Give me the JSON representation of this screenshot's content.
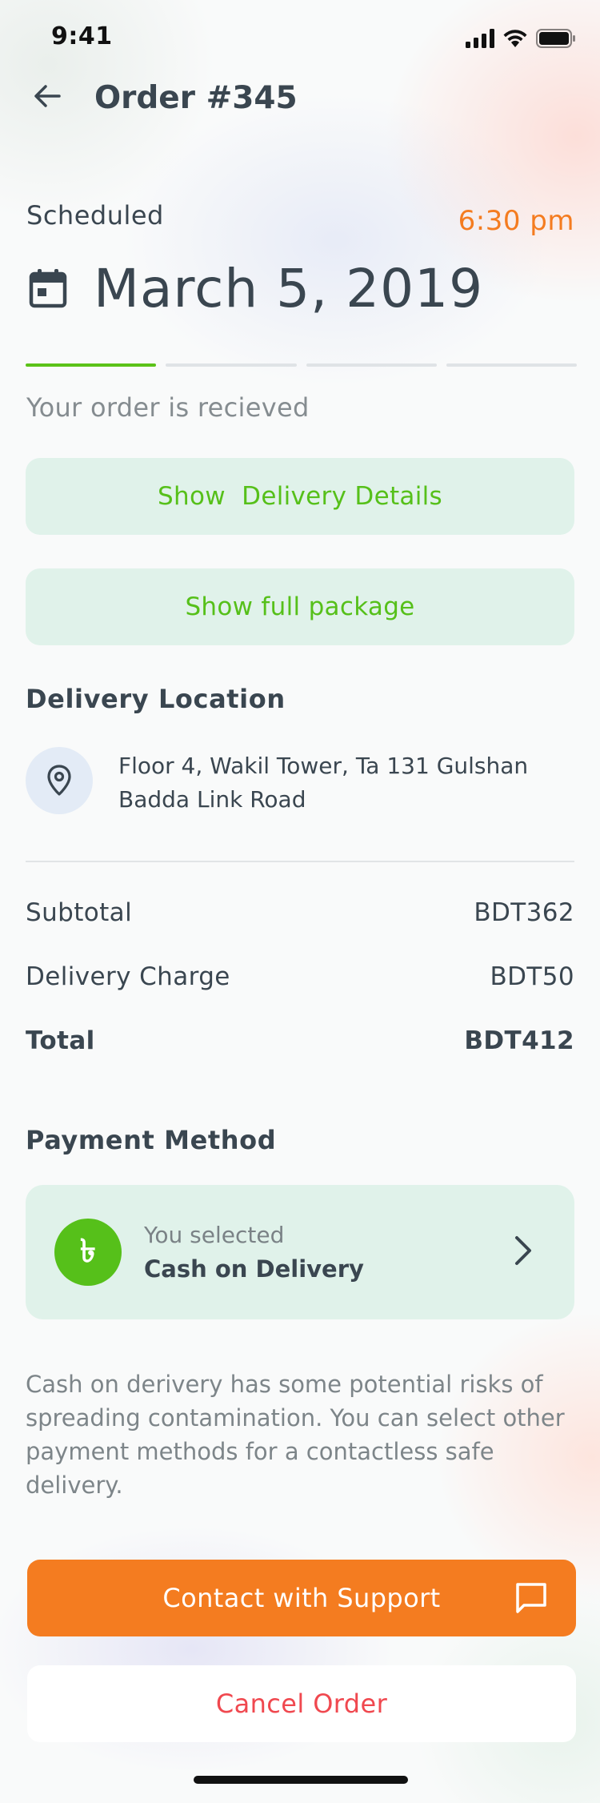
{
  "status_bar": {
    "time": "9:41"
  },
  "header": {
    "title": "Order #345"
  },
  "schedule": {
    "label": "Scheduled",
    "time": "6:30 pm",
    "date": "March 5, 2019",
    "progress_steps_total": 4,
    "progress_steps_done": 1,
    "status_text": "Your order is recieved"
  },
  "buttons": {
    "delivery_details": "Show  Delivery Details",
    "full_package": "Show full package",
    "contact_support": "Contact with Support",
    "cancel_order": "Cancel Order"
  },
  "delivery_location": {
    "title": "Delivery Location",
    "address_line1": "Floor 4, Wakil Tower, Ta 131 Gulshan",
    "address_line2": "Badda Link Road"
  },
  "summary": {
    "subtotal_label": "Subtotal",
    "subtotal_value": "BDT362",
    "delivery_label": "Delivery Charge",
    "delivery_value": "BDT50",
    "total_label": "Total",
    "total_value": "BDT412"
  },
  "payment": {
    "title": "Payment Method",
    "selected_label": "You selected",
    "method": "Cash on Delivery",
    "currency_symbol": "৳",
    "note": "Cash on derivery has some potential risks of spreading contamination. You can select other payment methods for a contactless safe delivery."
  },
  "colors": {
    "accent_orange": "#f47c20",
    "accent_green": "#56c01a",
    "light_green_bg": "#e0f2ea",
    "danger_red": "#f0484f",
    "text_dark": "#3a4650"
  },
  "icons": {
    "back": "arrow-left-icon",
    "calendar": "calendar-icon",
    "location": "location-pin-icon",
    "currency": "taka-icon",
    "chevron": "chevron-right-icon",
    "chat": "chat-icon"
  }
}
